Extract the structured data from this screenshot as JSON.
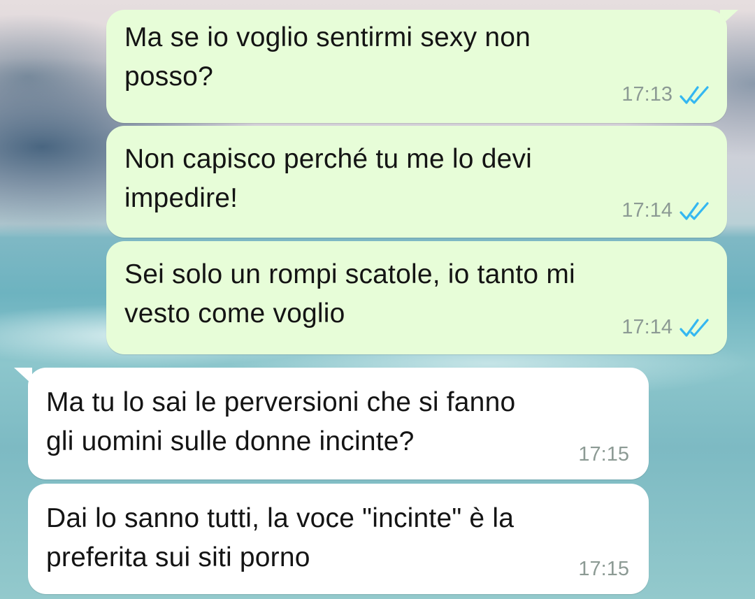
{
  "messages": [
    {
      "text": "Ma se io voglio sentirmi sexy non\nposso?",
      "time": "17:13",
      "direction": "outgoing",
      "status": "read"
    },
    {
      "text": "Non capisco perché tu me lo devi\nimpedire!",
      "time": "17:14",
      "direction": "outgoing",
      "status": "read"
    },
    {
      "text": "Sei solo un rompi scatole, io tanto mi\nvesto come voglio",
      "time": "17:14",
      "direction": "outgoing",
      "status": "read"
    },
    {
      "text": "Ma tu lo sai le perversioni che si fanno\ngli uomini sulle donne incinte?",
      "time": "17:15",
      "direction": "incoming"
    },
    {
      "text": "Dai lo sanno tutti, la voce \"incinte\" è la\npreferita sui siti porno",
      "time": "17:15",
      "direction": "incoming"
    }
  ],
  "icons": {
    "read_receipt": "double-check-icon"
  },
  "colors": {
    "outgoing_bubble": "#e7fdd8",
    "incoming_bubble": "#ffffff",
    "read_tick": "#34b7f1",
    "timestamp": "#8c9a94"
  }
}
